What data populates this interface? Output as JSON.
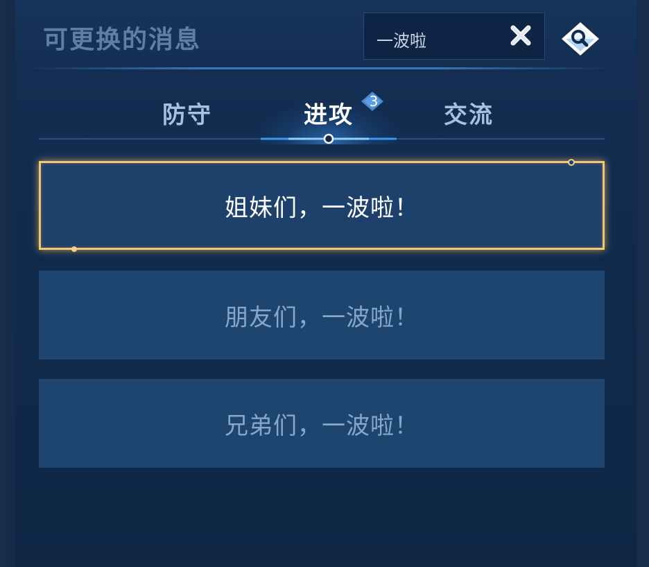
{
  "header": {
    "title": "可更换的消息",
    "search": {
      "value": "一波啦"
    }
  },
  "tabs": [
    {
      "label": "防守",
      "active": false
    },
    {
      "label": "进攻",
      "active": true,
      "badge": "3"
    },
    {
      "label": "交流",
      "active": false
    }
  ],
  "messages": [
    {
      "text": "姐妹们，一波啦！",
      "selected": true
    },
    {
      "text": "朋友们，一波啦！",
      "selected": false
    },
    {
      "text": "兄弟们，一波啦！",
      "selected": false
    }
  ],
  "icons": {
    "clear": "close-icon",
    "search": "search-icon"
  },
  "colors": {
    "panel": "#132e52",
    "item": "#1e4470",
    "selected_border": "#f0c878",
    "accent": "#4aa6ff"
  }
}
